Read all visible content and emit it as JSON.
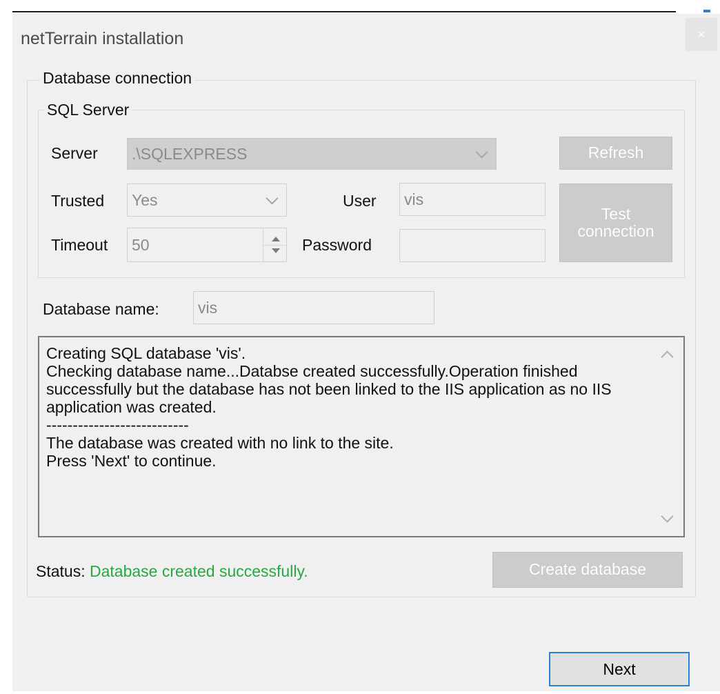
{
  "window": {
    "title": "netTerrain installation",
    "close_glyph": "×"
  },
  "database_connection": {
    "legend": "Database connection",
    "sql_server": {
      "legend": "SQL Server",
      "server_label": "Server",
      "server_value": ".\\SQLEXPRESS",
      "refresh_label": "Refresh",
      "trusted_label": "Trusted",
      "trusted_value": "Yes",
      "user_label": "User",
      "user_value": "vis",
      "timeout_label": "Timeout",
      "timeout_value": "50",
      "password_label": "Password",
      "password_value": "",
      "test_connection_label": "Test connection"
    },
    "database_name_label": "Database name:",
    "database_name_value": "vis",
    "log_text": "Creating SQL database 'vis'.\nChecking database name...Databse created successfully.Operation finished successfully but the database has not been linked to the IIS application as no IIS application was created.\n---------------------------\nThe database was created with no link to the site.\nPress 'Next' to continue.",
    "status_label": "Status:",
    "status_value": "Database created successfully.",
    "create_database_label": "Create database"
  },
  "footer": {
    "next_label": "Next"
  },
  "colors": {
    "status_success": "#27a843",
    "focus_border": "#2b7fd6",
    "window_bg": "#f0f0f0"
  },
  "icons": {
    "close": "close-icon",
    "dropdown": "chevron-down-icon",
    "spinner": "spinner-arrows-icon"
  }
}
